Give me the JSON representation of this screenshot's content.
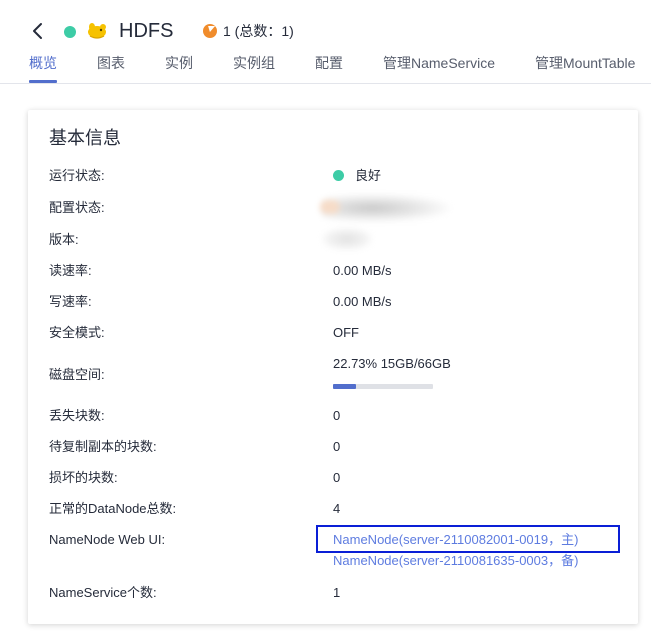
{
  "header": {
    "title": "HDFS",
    "alarm": "1 (总数：1)",
    "status_color": "#3dcca6",
    "icons": [
      "chevron-left-icon",
      "status-dot-icon",
      "hdfs-logo-icon",
      "alarm-icon"
    ]
  },
  "tabs": [
    {
      "label": "概览",
      "active": true
    },
    {
      "label": "图表",
      "active": false
    },
    {
      "label": "实例",
      "active": false
    },
    {
      "label": "实例组",
      "active": false
    },
    {
      "label": "配置",
      "active": false
    },
    {
      "label": "管理NameService",
      "active": false
    },
    {
      "label": "管理MountTable",
      "active": false
    }
  ],
  "card": {
    "title": "基本信息",
    "rows": {
      "run_status": {
        "label": "运行状态:",
        "value": "良好"
      },
      "config_status": {
        "label": "配置状态:"
      },
      "version": {
        "label": "版本:"
      },
      "read_rate": {
        "label": "读速率:",
        "value": "0.00 MB/s"
      },
      "write_rate": {
        "label": "写速率:",
        "value": "0.00 MB/s"
      },
      "safe_mode": {
        "label": "安全模式:",
        "value": "OFF"
      },
      "disk_space": {
        "label": "磁盘空间:",
        "value": "22.73% 15GB/66GB",
        "percent": 22.73
      },
      "lost_blocks": {
        "label": "丢失块数:",
        "value": "0"
      },
      "pending_replication": {
        "label": "待复制副本的块数:",
        "value": "0"
      },
      "corrupt_blocks": {
        "label": "损坏的块数:",
        "value": "0"
      },
      "normal_datanodes": {
        "label": "正常的DataNode总数:",
        "value": "4"
      },
      "namenode_webui": {
        "label": "NameNode Web UI:",
        "links": [
          "NameNode(server-2110082001-0019，主)",
          "NameNode(server-2110081635-0003，备)"
        ]
      },
      "nameservice_count": {
        "label": "NameService个数:",
        "value": "1"
      }
    }
  },
  "colors": {
    "accent": "#526ecc",
    "link": "#5e7ce0",
    "ok": "#3dcca6",
    "alarm": "#f08c2c",
    "highlight": "#0a1fd6"
  }
}
